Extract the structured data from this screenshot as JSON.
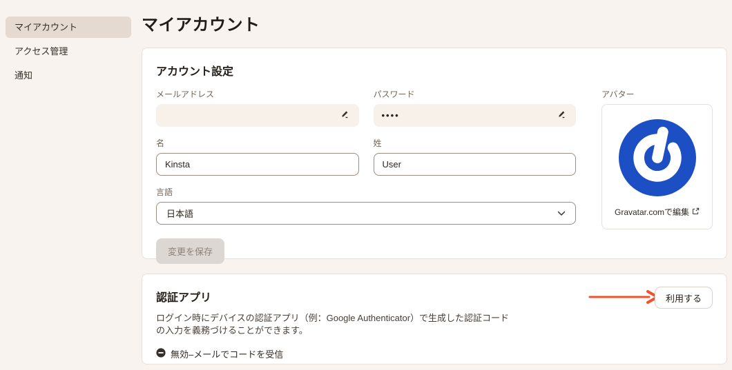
{
  "page": {
    "title": "マイアカウント"
  },
  "sidebar": {
    "items": [
      {
        "label": "マイアカウント",
        "active": true
      },
      {
        "label": "アクセス管理",
        "active": false
      },
      {
        "label": "通知",
        "active": false
      }
    ]
  },
  "account_settings": {
    "heading": "アカウント設定",
    "email": {
      "label": "メールアドレス",
      "redacted": true
    },
    "password": {
      "label": "パスワード",
      "value": "••••"
    },
    "first_name": {
      "label": "名",
      "value": "Kinsta"
    },
    "last_name": {
      "label": "姓",
      "value": "User"
    },
    "language": {
      "label": "言語",
      "value": "日本語"
    },
    "save_label": "変更を保存",
    "avatar": {
      "label": "アバター",
      "link_label": "Gravatar.comで編集"
    }
  },
  "authenticator": {
    "heading": "認証アプリ",
    "description": "ログイン時にデバイスの認証アプリ（例：Google Authenticator）で生成した認証コードの入力を義務づけることができます。",
    "status": "無効–メールでコードを受信",
    "enable_button": "利用する"
  },
  "colors": {
    "page_bg": "#f8f3ee",
    "sidebar_active_bg": "#e4dad1",
    "card_border": "#ecdfd5",
    "filled_input_bg": "#f8f1ea",
    "outline_input_border": "#9c8a7d",
    "gravatar_blue": "#1d4fc4",
    "annotation_arrow": "#f1512b",
    "disabled_button_bg": "#dcd7d2"
  }
}
